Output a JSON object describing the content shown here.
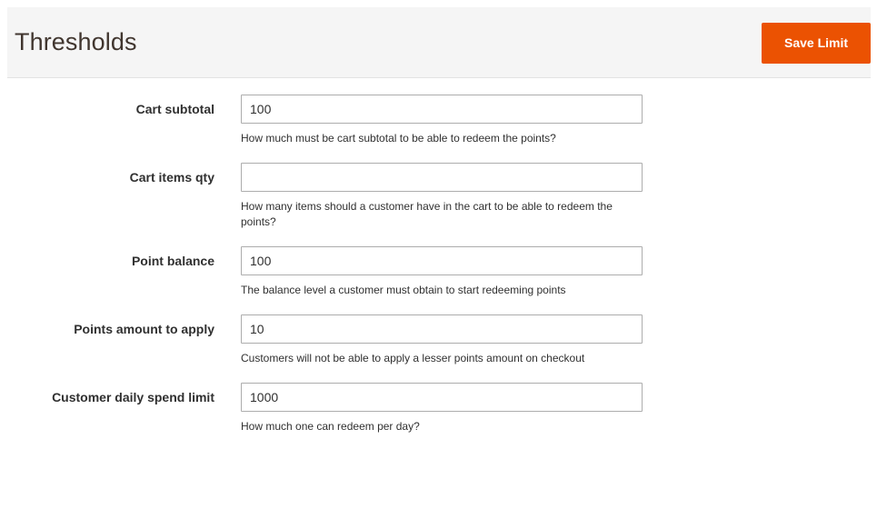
{
  "header": {
    "title": "Thresholds",
    "save_button_label": "Save Limit",
    "accent_color": "#eb5202",
    "background_color": "#f5f5f5"
  },
  "form": {
    "fields": [
      {
        "label": "Cart subtotal",
        "value": "100",
        "placeholder": "",
        "note": "How much must be cart subtotal to be able to redeem the points?"
      },
      {
        "label": "Cart items qty",
        "value": "",
        "placeholder": "",
        "note": "How many items should a customer have in the cart to be able to redeem the points?"
      },
      {
        "label": "Point balance",
        "value": "100",
        "placeholder": "",
        "note": "The balance level a customer must obtain to start redeeming points"
      },
      {
        "label": "Points amount to apply",
        "value": "10",
        "placeholder": "",
        "note": "Customers will not be able to apply a lesser points amount on checkout"
      },
      {
        "label": "Customer daily spend limit",
        "value": "1000",
        "placeholder": "",
        "note": "How much one can redeem per day?"
      }
    ]
  }
}
